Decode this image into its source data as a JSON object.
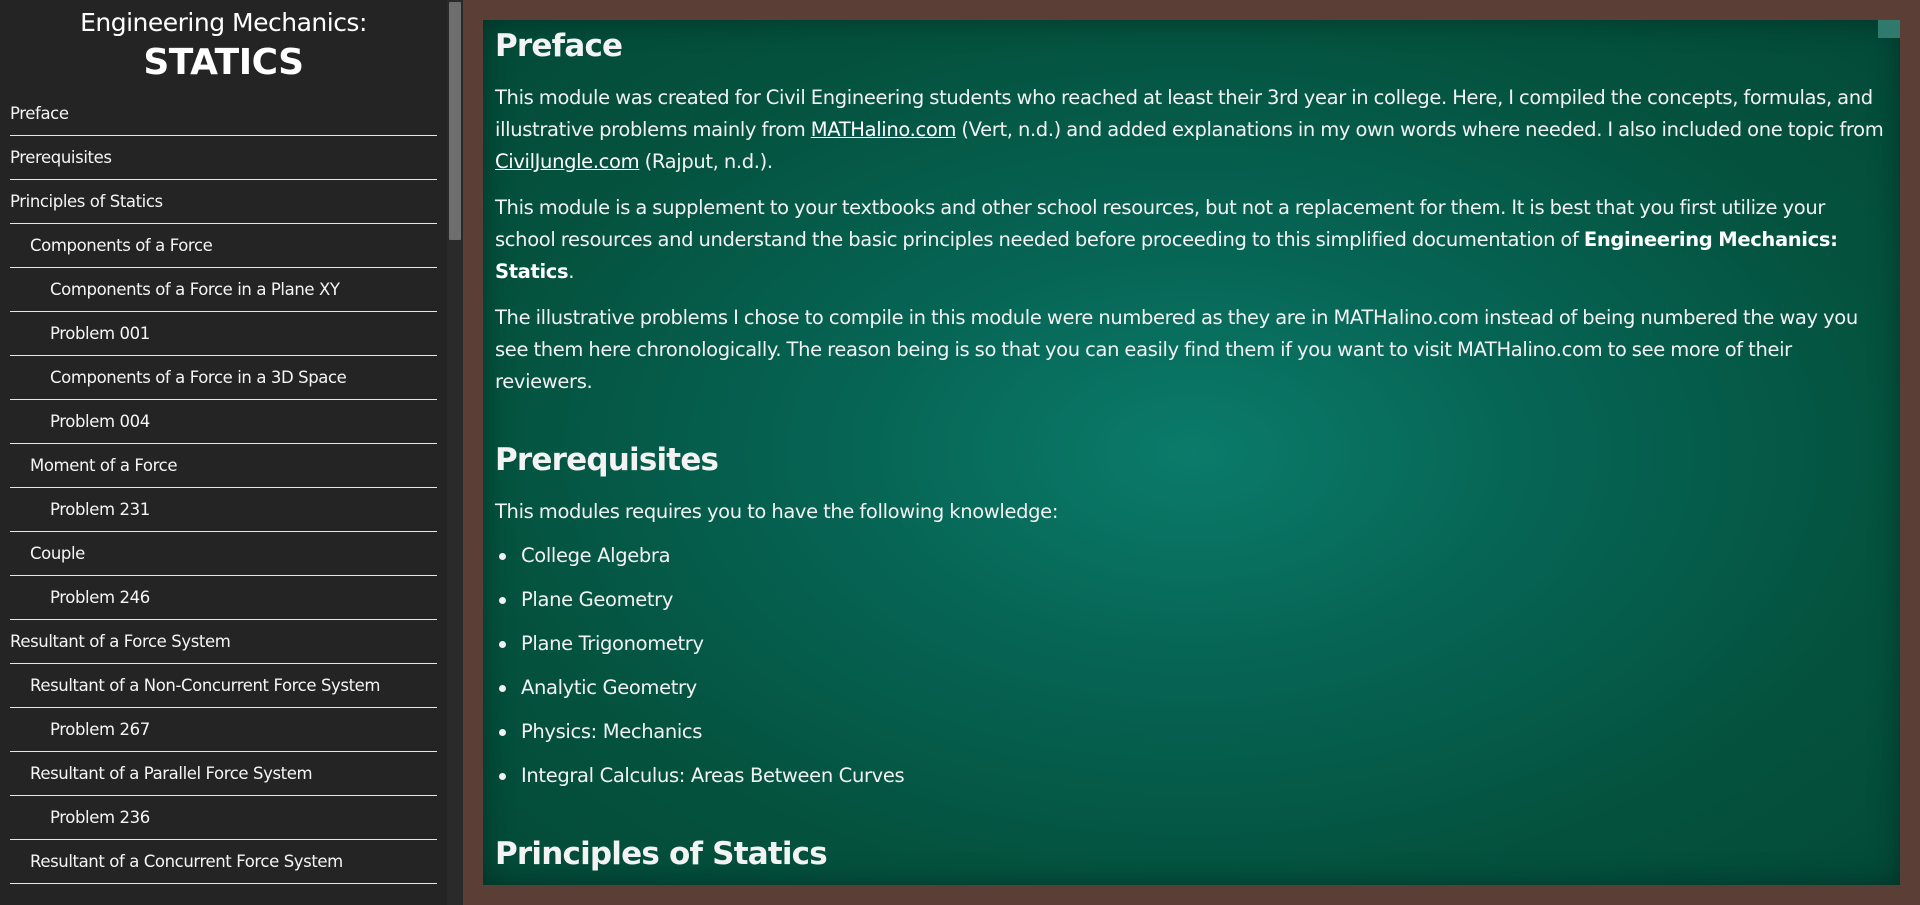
{
  "sidebar": {
    "title_top": "Engineering Mechanics:",
    "title_main": "STATICS",
    "items": [
      {
        "label": "Preface"
      },
      {
        "label": "Prerequisites"
      },
      {
        "label": "Principles of Statics"
      },
      {
        "label": "Components of a Force"
      },
      {
        "label": "Components of a Force in a Plane XY"
      },
      {
        "label": "Problem 001"
      },
      {
        "label": "Components of a Force in a 3D Space"
      },
      {
        "label": "Problem 004"
      },
      {
        "label": "Moment of a Force"
      },
      {
        "label": "Problem 231"
      },
      {
        "label": "Couple"
      },
      {
        "label": "Problem 246"
      },
      {
        "label": "Resultant of a Force System"
      },
      {
        "label": "Resultant of a Non-Concurrent Force System"
      },
      {
        "label": "Problem 267"
      },
      {
        "label": "Resultant of a Parallel Force System"
      },
      {
        "label": "Problem 236"
      },
      {
        "label": "Resultant of a Concurrent Force System"
      }
    ]
  },
  "content": {
    "preface": {
      "title": "Preface",
      "p1_a": "This module was created for Civil Engineering students who reached at least their 3rd year in college. Here, I compiled the concepts, formulas, and illustrative problems mainly from ",
      "p1_link1": "MATHalino.com",
      "p1_b": " (Vert, n.d.) and added explanations in my own words where needed. I also included one topic from ",
      "p1_link2": "CivilJungle.com",
      "p1_c": " (Rajput, n.d.).",
      "p2_a": "This module is a supplement to your textbooks and other school resources, but not a replacement for them. It is best that you first utilize your school resources and understand the basic principles needed before proceeding to this simplified documentation of ",
      "p2_strong": "Engineering Mechanics: Statics",
      "p2_b": ".",
      "p3": "The illustrative problems I chose to compile in this module were numbered as they are in MATHalino.com instead of being numbered the way you see them here chronologically. The reason being is so that you can easily find them if you want to visit MATHalino.com to see more of their reviewers."
    },
    "prerequisites": {
      "title": "Prerequisites",
      "intro": "This modules requires you to have the following knowledge:",
      "items": [
        "College Algebra",
        "Plane Geometry",
        "Plane Trigonometry",
        "Analytic Geometry",
        "Physics: Mechanics",
        "Integral Calculus: Areas Between Curves"
      ]
    },
    "principles": {
      "title": "Principles of Statics"
    }
  },
  "colors": {
    "sidebar_bg": "#242424",
    "board_frame": "#5b3f37",
    "board_green": "#066454",
    "text": "#f2f2f2"
  }
}
